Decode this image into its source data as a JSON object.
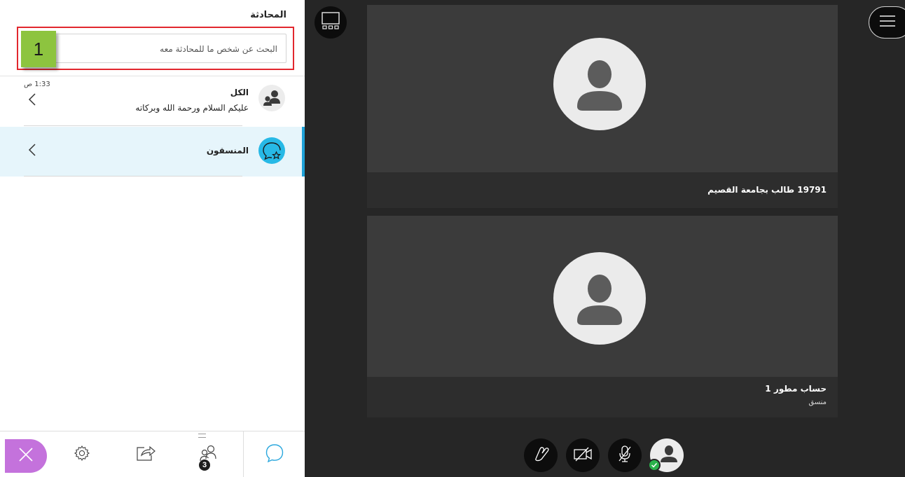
{
  "chat_panel": {
    "title": "المحادثة",
    "search": {
      "placeholder": "البحث عن شخص ما للمحادثة معه",
      "value": ""
    },
    "step_badge": "1",
    "conversations": [
      {
        "name": "الكل",
        "last_message": "عليكم السلام ورحمة الله وبركاته",
        "time": "1:33 ص",
        "icon": "group-avatar-icon"
      },
      {
        "name": "المنسقون",
        "last_message": "",
        "time": "",
        "icon": "moderators-chat-icon",
        "selected": true
      }
    ],
    "bottom_tabs": [
      {
        "name": "close",
        "icon": "close-icon"
      },
      {
        "name": "settings",
        "icon": "gear-icon"
      },
      {
        "name": "share-content",
        "icon": "share-icon"
      },
      {
        "name": "attendees",
        "icon": "attendees-icon",
        "badge": "3"
      },
      {
        "name": "chat",
        "icon": "chat-bubble-icon",
        "active": true
      }
    ]
  },
  "session": {
    "tiles": [
      {
        "name": "19791 طالب بجامعة القصيم",
        "role": ""
      },
      {
        "name": "حساب مطور 1",
        "role": "منسق"
      }
    ],
    "controls": [
      {
        "name": "raise-hand",
        "icon": "raise-hand-icon"
      },
      {
        "name": "camera",
        "icon": "camera-off-icon"
      },
      {
        "name": "microphone",
        "icon": "microphone-off-icon"
      },
      {
        "name": "profile",
        "icon": "profile-avatar-icon",
        "status": "available"
      }
    ]
  },
  "colors": {
    "accent_blue": "#1ea2d8",
    "close_purple": "#c472dc",
    "highlight_red": "#e2272e",
    "badge_green": "#8dc43f",
    "status_green": "#2ab24b"
  }
}
